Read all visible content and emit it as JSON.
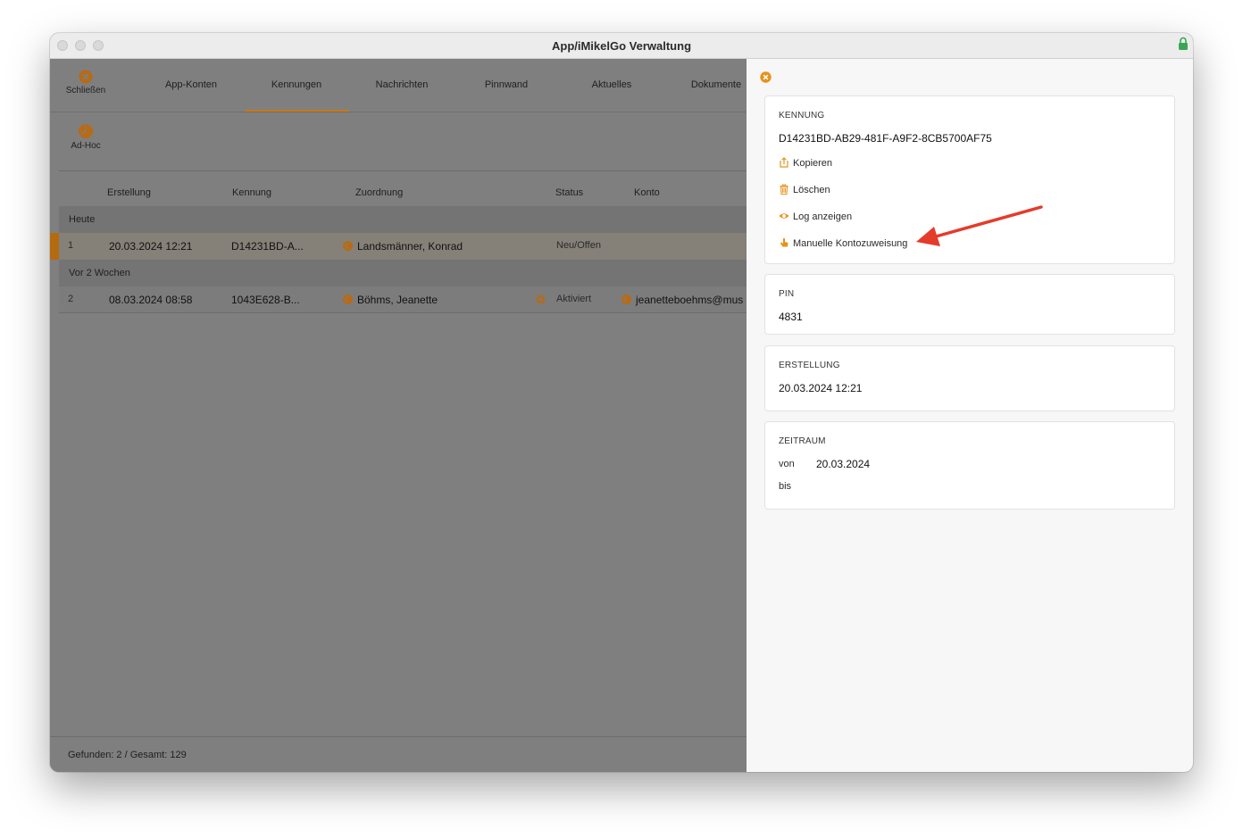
{
  "window": {
    "title": "App/iMikelGo Verwaltung"
  },
  "toolbar": {
    "close_label": "Schließen",
    "tabs": [
      {
        "label": "App-Konten"
      },
      {
        "label": "Kennungen",
        "active": true
      },
      {
        "label": "Nachrichten"
      },
      {
        "label": "Pinnwand"
      },
      {
        "label": "Aktuelles"
      },
      {
        "label": "Dokumente"
      }
    ],
    "adhoc_label": "Ad-Hoc"
  },
  "table": {
    "columns": [
      "Erstellung",
      "Kennung",
      "Zuordnung",
      "Status",
      "Konto"
    ],
    "groups": [
      {
        "label": "Heute",
        "rows": [
          {
            "nr": "1",
            "erstellung": "20.03.2024 12:21",
            "kennung": "D14231BD-A...",
            "zuordnung": "Landsmänner, Konrad",
            "status": "Neu/Offen",
            "konto": ""
          }
        ]
      },
      {
        "label": "Vor 2 Wochen",
        "rows": [
          {
            "nr": "2",
            "erstellung": "08.03.2024 08:58",
            "kennung": "1043E628-B...",
            "zuordnung": "Böhms, Jeanette",
            "status": "Aktiviert",
            "konto": "jeanetteboehms@mus"
          }
        ]
      }
    ]
  },
  "footer": {
    "text": "Gefunden: 2 / Gesamt: 129"
  },
  "detail": {
    "kennung": {
      "label": "KENNUNG",
      "value": "D14231BD-AB29-481F-A9F2-8CB5700AF75",
      "actions": [
        "Kopieren",
        "Löschen",
        "Log anzeigen",
        "Manuelle Kontozuweisung"
      ]
    },
    "pin": {
      "label": "PIN",
      "value": "4831"
    },
    "erstellung": {
      "label": "ERSTELLUNG",
      "value": "20.03.2024 12:21"
    },
    "zeitraum": {
      "label": "ZEITRAUM",
      "von_label": "von",
      "von_value": "20.03.2024",
      "bis_label": "bis",
      "bis_value": ""
    }
  },
  "colors": {
    "accent": "#e8921c",
    "annotation_arrow": "#e53b2a",
    "dim_overlay": "#7f7f7f"
  }
}
